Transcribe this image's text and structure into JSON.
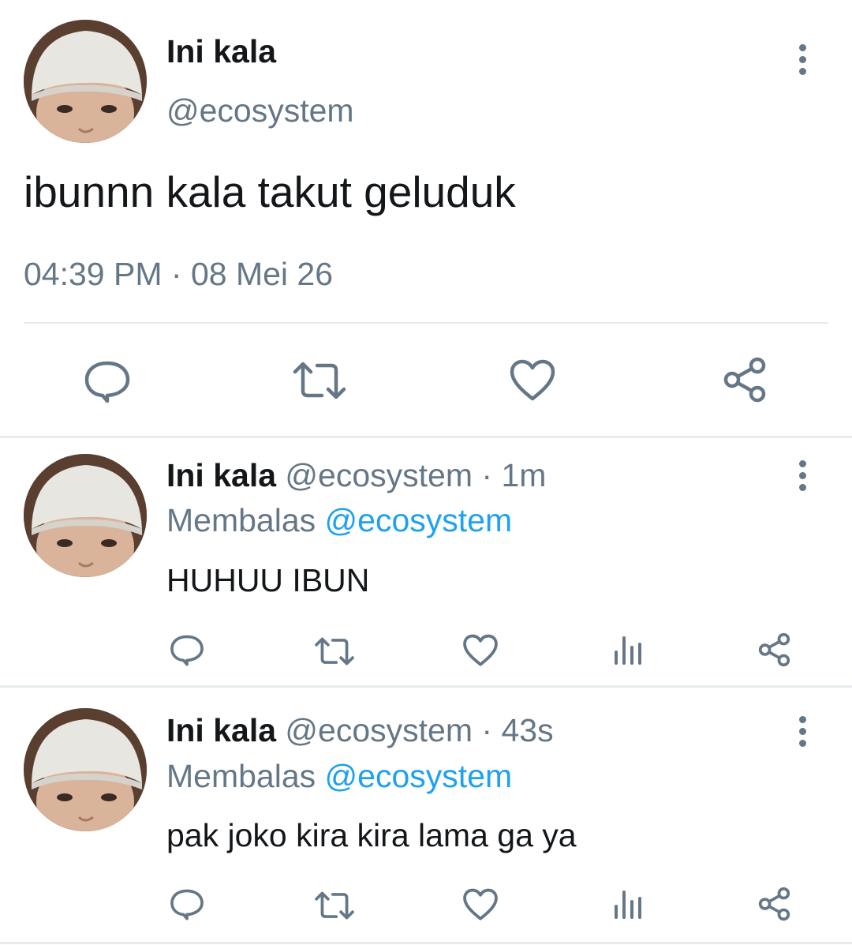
{
  "main_tweet": {
    "display_name": "Ini kala",
    "handle": "@ecosystem",
    "text": "ibunnn kala takut geluduk",
    "time": "04:39 PM",
    "separator": "·",
    "date": "08 Mei 26"
  },
  "replies": [
    {
      "display_name": "Ini kala",
      "handle": "@ecosystem",
      "separator": "·",
      "age": "1m",
      "replying_label": "Membalas",
      "replying_to": "@ecosystem",
      "text": "HUHUU IBUN"
    },
    {
      "display_name": "Ini kala",
      "handle": "@ecosystem",
      "separator": "·",
      "age": "43s",
      "replying_label": "Membalas",
      "replying_to": "@ecosystem",
      "text": "pak joko kira kira lama ga ya"
    }
  ],
  "icons": {
    "reply": "reply-icon",
    "retweet": "retweet-icon",
    "like": "heart-icon",
    "analytics": "analytics-icon",
    "share": "share-icon",
    "more": "more-vertical-icon"
  },
  "colors": {
    "text": "#14171a",
    "muted": "#657786",
    "link": "#1da1f2",
    "divider": "#e6ecf0"
  }
}
